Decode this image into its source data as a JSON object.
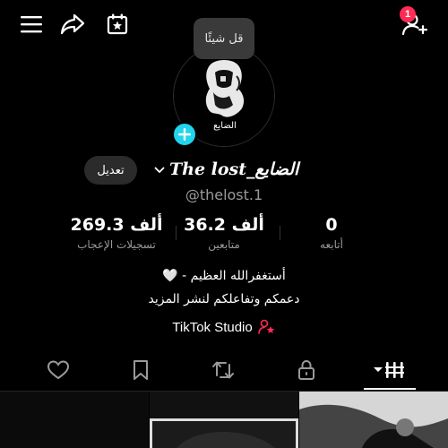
{
  "header": {
    "notification_count": "1",
    "icons": [
      "menu-icon",
      "share-icon",
      "calendar-star-icon",
      "add-user-icon"
    ]
  },
  "tooltip": {
    "text": "قل شيئًا"
  },
  "profile": {
    "avatar_caption": "الضايع",
    "edit_label": "تعديل",
    "display_name": "The lost_الضايع",
    "handle": "@thelost.1"
  },
  "stats": {
    "likes": {
      "value": "269.3 ألف",
      "label": "تسجيلات الإعجاب"
    },
    "followers": {
      "value": "36.2 ألف",
      "label": "متابعين"
    },
    "following": {
      "value": "0",
      "label": "أتابعه"
    }
  },
  "bio": {
    "line1": "أستغفرالله العظيم - 🤍",
    "line2": "دعمكم وتفاعلكم لنشر المزيد"
  },
  "studio": {
    "label": "TikTok Studio"
  },
  "tabs": [
    "liked-icon",
    "favorites-icon",
    "reposts-icon",
    "private-icon",
    "videos-grid-icon"
  ],
  "colors": {
    "accent_pink": "#fe2c55",
    "plus_cyan": "#20d5ec",
    "background": "#000000"
  }
}
